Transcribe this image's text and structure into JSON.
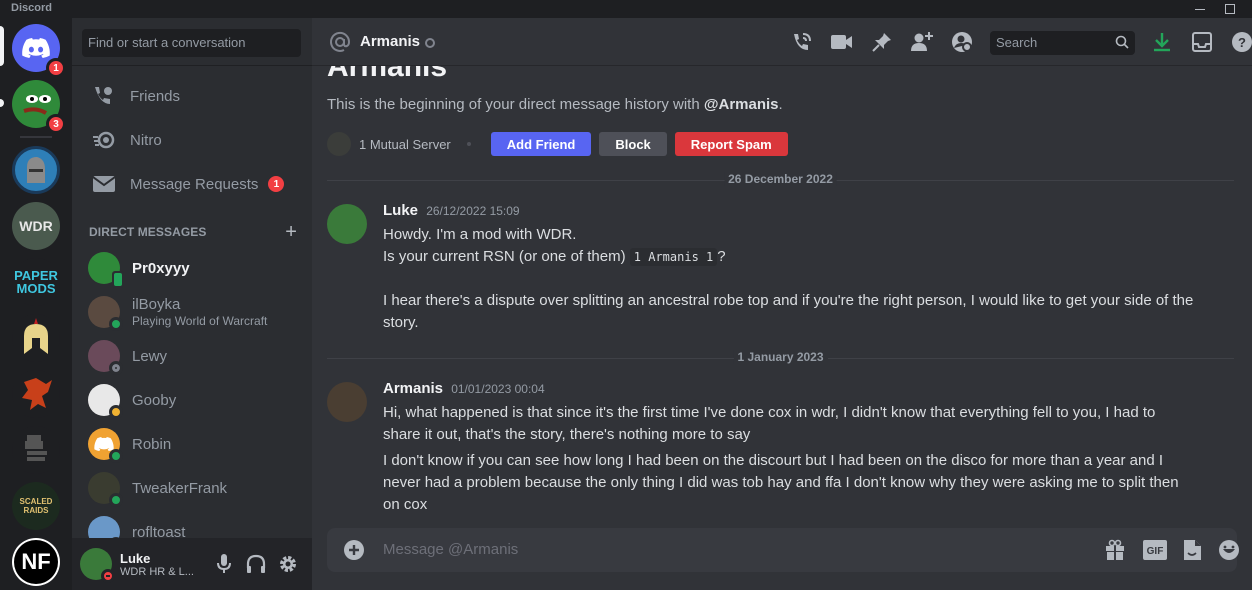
{
  "window": {
    "app_name": "Discord"
  },
  "guilds": [
    {
      "name": "home",
      "label": "",
      "badge": "1",
      "color": "#5865f2"
    },
    {
      "name": "pepe-server",
      "label": "",
      "badge": "3",
      "color": "#2f8a3a"
    },
    {
      "name": "knight-server",
      "label": "",
      "badge": "",
      "color": "#2e7fb8"
    },
    {
      "name": "wdr",
      "label": "WDR",
      "badge": "",
      "color": "#4a5a4e"
    },
    {
      "name": "paper-mods",
      "label": "PAPER MODS",
      "badge": "",
      "color": "#1e1f22"
    },
    {
      "name": "spartan",
      "label": "",
      "badge": "",
      "color": "#1e1f22"
    },
    {
      "name": "dragon",
      "label": "",
      "badge": "",
      "color": "#1e1f22"
    },
    {
      "name": "grey-helm",
      "label": "",
      "badge": "",
      "color": "#1e1f22"
    },
    {
      "name": "scaled-raids",
      "label": "SCALED RAIDS",
      "badge": "",
      "color": "#1c2a1f"
    },
    {
      "name": "nf",
      "label": "NF",
      "badge": "",
      "color": "#000000"
    }
  ],
  "sidebar": {
    "search_placeholder": "Find or start a conversation",
    "nav": [
      {
        "label": "Friends",
        "icon": "friends-icon",
        "badge": ""
      },
      {
        "label": "Nitro",
        "icon": "nitro-icon",
        "badge": ""
      },
      {
        "label": "Message Requests",
        "icon": "envelope-icon",
        "badge": "1"
      }
    ],
    "dm_header": "DIRECT MESSAGES",
    "dms": [
      {
        "name": "Pr0xyyy",
        "sub": "",
        "status": "mobile",
        "unread": true,
        "avatar_color": "#2f8a3a"
      },
      {
        "name": "ilBoyka",
        "sub": "Playing World of Warcraft",
        "status": "online",
        "unread": false,
        "avatar_color": "#5a4a40"
      },
      {
        "name": "Lewy",
        "sub": "",
        "status": "offline",
        "unread": false,
        "avatar_color": "#6a4a5a"
      },
      {
        "name": "Gooby",
        "sub": "",
        "status": "idle",
        "unread": false,
        "avatar_color": "#e8e8e8"
      },
      {
        "name": "Robin",
        "sub": "",
        "status": "online",
        "unread": false,
        "avatar_color": "#f0a232"
      },
      {
        "name": "TweakerFrank",
        "sub": "",
        "status": "online",
        "unread": false,
        "avatar_color": "#3a3c30"
      },
      {
        "name": "rofltoast",
        "sub": "",
        "status": "online",
        "unread": false,
        "avatar_color": "#6a98c8"
      }
    ],
    "user": {
      "name": "Luke",
      "status_text": "WDR HR & L..."
    }
  },
  "header": {
    "title": "Armanis",
    "search_placeholder": "Search"
  },
  "chat": {
    "big_name": "Armanis",
    "intro_prefix": "This is the beginning of your direct message history with ",
    "intro_mention": "@Armanis",
    "intro_suffix": ".",
    "mutual_servers": "1 Mutual Server",
    "buttons": {
      "add_friend": "Add Friend",
      "block": "Block",
      "report_spam": "Report Spam"
    },
    "dividers": [
      "26 December 2022",
      "1 January 2023"
    ],
    "messages": [
      {
        "author": "Luke",
        "timestamp": "26/12/2022 15:09",
        "lines": {
          "l1": "Howdy. I'm a mod with WDR.",
          "l2_prefix": "Is your current RSN (or one of them) ",
          "l2_code": "1 Armanis 1",
          "l2_suffix": "?",
          "l3": "I hear there's a dispute over splitting an ancestral robe top and if you're the right person, I would like to get your side of the story."
        }
      },
      {
        "author": "Armanis",
        "timestamp": "01/01/2023 00:04",
        "lines": {
          "l1": "Hi, what happened is that since it's the first time I've done cox in wdr, I didn't know that everything fell to you, I had to share it out, that's the story, there's nothing more to say",
          "l2": "I don't know if you can see how long I had been on the discourt but I had been on the disco for more than a year and I never had a problem because the only thing I did was tob hay and ffa I don't know why they were asking me to split then on cox"
        }
      }
    ],
    "composer_placeholder": "Message @Armanis"
  },
  "colors": {
    "online": "#23a55a",
    "idle": "#f0b232",
    "dnd": "#f23f43",
    "offline": "#80848e",
    "blurple": "#5865f2",
    "download": "#23a55a"
  }
}
